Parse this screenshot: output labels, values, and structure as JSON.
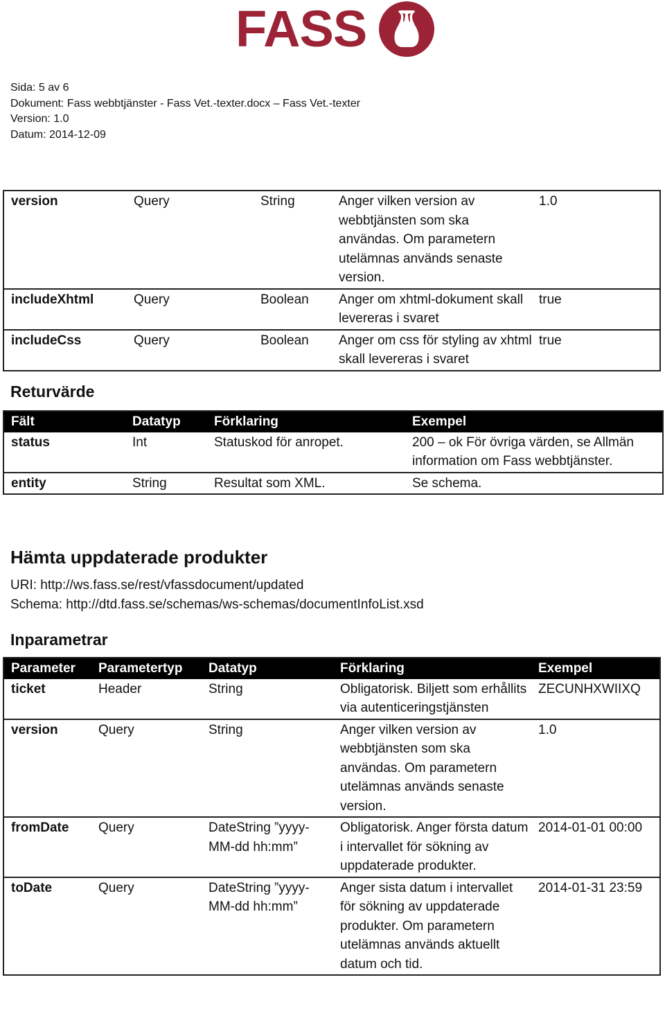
{
  "logo": {
    "text": "FASS",
    "icon": "amphora-icon",
    "brand_color": "#9b2335"
  },
  "meta": {
    "page": "Sida: 5 av 6",
    "document": "Dokument: Fass webbtjänster - Fass Vet.-texter.docx – Fass Vet.-texter",
    "version": "Version: 1.0",
    "date": "Datum: 2014-12-09"
  },
  "table1": {
    "rows": [
      {
        "param": "version",
        "type": "Query",
        "datatype": "String",
        "desc": "Anger vilken version av webbtjänsten som ska användas. Om parametern utelämnas används senaste version.",
        "example": "1.0"
      },
      {
        "param": "includeXhtml",
        "type": "Query",
        "datatype": "Boolean",
        "desc": "Anger om xhtml-dokument skall levereras i svaret",
        "example": "true"
      },
      {
        "param": "includeCss",
        "type": "Query",
        "datatype": "Boolean",
        "desc": "Anger om css för styling av xhtml skall levereras i svaret",
        "example": "true"
      }
    ]
  },
  "returvarde": {
    "heading": "Returvärde",
    "headers": [
      "Fält",
      "Datatyp",
      "Förklaring",
      "Exempel"
    ],
    "rows": [
      {
        "field": "status",
        "datatype": "Int",
        "desc": "Statuskod för anropet.",
        "example": "200 – ok\nFör övriga värden, se Allmän information om Fass webbtjänster."
      },
      {
        "field": "entity",
        "datatype": "String",
        "desc": "Resultat som XML.",
        "example": "Se schema."
      }
    ]
  },
  "section": {
    "heading": "Hämta uppdaterade produkter",
    "uri": "URI: http://ws.fass.se/rest/vfassdocument/updated",
    "schema": "Schema: http://dtd.fass.se/schemas/ws-schemas/documentInfoList.xsd"
  },
  "inparametrar": {
    "heading": "Inparametrar",
    "headers": [
      "Parameter",
      "Parametertyp",
      "Datatyp",
      "Förklaring",
      "Exempel"
    ],
    "rows": [
      {
        "param": "ticket",
        "type": "Header",
        "datatype": "String",
        "desc": "Obligatorisk. Biljett som erhållits via autenticeringstjänsten",
        "example": "ZECUNHXWIIXQ"
      },
      {
        "param": "version",
        "type": "Query",
        "datatype": "String",
        "desc": "Anger vilken version av webbtjänsten som ska användas. Om parametern utelämnas används senaste version.",
        "example": "1.0"
      },
      {
        "param": "fromDate",
        "type": "Query",
        "datatype": "DateString ”yyyy-MM-dd hh:mm”",
        "desc": "Obligatorisk. Anger första datum i intervallet för sökning av uppdaterade produkter.",
        "example": "2014-01-01 00:00"
      },
      {
        "param": "toDate",
        "type": "Query",
        "datatype": "DateString ”yyyy-MM-dd hh:mm”",
        "desc": "Anger sista datum i intervallet för sökning av uppdaterade produkter. Om parametern utelämnas används aktuellt datum och tid.",
        "example": "2014-01-31 23:59"
      }
    ]
  }
}
